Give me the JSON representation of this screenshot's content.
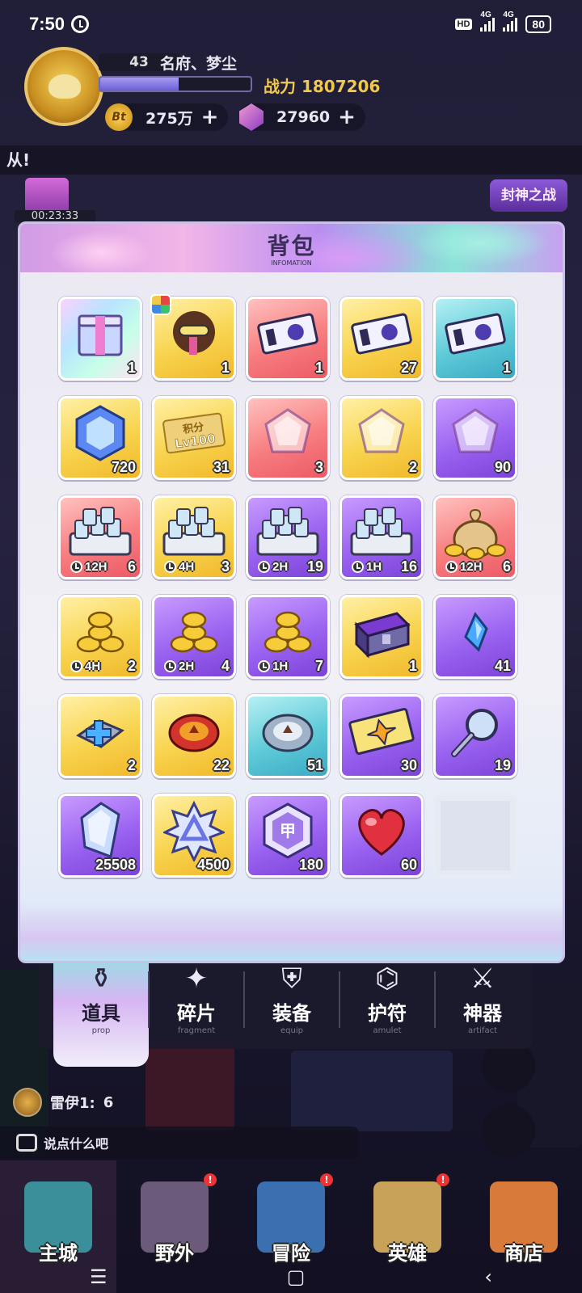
{
  "status_bar": {
    "time": "7:50",
    "network_hd": "HD",
    "net1": "4G",
    "net2": "4G",
    "battery": "80"
  },
  "player": {
    "level": "43",
    "name": "名府、梦尘",
    "exp_fraction": 0.52,
    "power_label": "战力",
    "power_value": "1807206",
    "coins": "275万",
    "coin_symbol": "Bt",
    "gems": "27960",
    "plus": "+"
  },
  "marquee_text": "从!",
  "gift_timer": "00:23:33",
  "event_button": "封神之战",
  "backpack": {
    "title": "背包",
    "subtitle": "INFOMATION",
    "items": [
      {
        "name": "mystery-box",
        "color": "rainbow",
        "icon": "box-icon",
        "count": "1"
      },
      {
        "name": "hero-card",
        "color": "gold",
        "icon": "hero-icon",
        "count": "1"
      },
      {
        "name": "ticket-red",
        "color": "red",
        "icon": "ticket-icon",
        "count": "1"
      },
      {
        "name": "ticket-gold",
        "color": "gold",
        "icon": "ticket-icon",
        "count": "27"
      },
      {
        "name": "ticket-cyan",
        "color": "cyan",
        "icon": "ticket-icon",
        "count": "1"
      },
      {
        "name": "blue-crystal",
        "color": "gold",
        "icon": "hex-gem-icon",
        "count": "720"
      },
      {
        "name": "points-card",
        "color": "gold",
        "icon": "points-card-icon",
        "label": "积分 Lv100",
        "count": "31"
      },
      {
        "name": "red-gem",
        "color": "red",
        "icon": "gem-icon",
        "count": "3"
      },
      {
        "name": "gold-gem",
        "color": "gold",
        "icon": "gem-icon",
        "count": "2"
      },
      {
        "name": "purple-gem",
        "color": "purple",
        "icon": "gem-icon",
        "count": "90"
      },
      {
        "name": "money-chest-12h",
        "color": "red",
        "icon": "cash-stack-icon",
        "timer": "12H",
        "count": "6"
      },
      {
        "name": "money-pile-4h",
        "color": "gold",
        "icon": "cash-stack-icon",
        "timer": "4H",
        "count": "3"
      },
      {
        "name": "money-pile-2h",
        "color": "purple",
        "icon": "cash-stack-icon",
        "timer": "2H",
        "count": "19"
      },
      {
        "name": "money-pile-1h",
        "color": "purple",
        "icon": "cash-stack-icon",
        "timer": "1H",
        "count": "16"
      },
      {
        "name": "coin-bag-12h",
        "color": "red",
        "icon": "coin-bag-icon",
        "timer": "12H",
        "count": "6"
      },
      {
        "name": "coins-4h",
        "color": "gold",
        "icon": "coin-pile-icon",
        "timer": "4H",
        "count": "2"
      },
      {
        "name": "coins-2h",
        "color": "purple",
        "icon": "coin-pile-icon",
        "timer": "2H",
        "count": "4"
      },
      {
        "name": "coins-1h",
        "color": "purple",
        "icon": "coin-pile-icon",
        "timer": "1H",
        "count": "7"
      },
      {
        "name": "purple-chest",
        "color": "gold",
        "icon": "chest-icon",
        "count": "1"
      },
      {
        "name": "blue-shard",
        "color": "purple",
        "icon": "shard-icon",
        "count": "41"
      },
      {
        "name": "cross-plate",
        "color": "gold",
        "icon": "cross-icon",
        "count": "2"
      },
      {
        "name": "red-token",
        "color": "gold",
        "icon": "red-token-icon",
        "count": "22"
      },
      {
        "name": "silver-token",
        "color": "cyan",
        "icon": "silver-token-icon",
        "count": "51"
      },
      {
        "name": "gold-card",
        "color": "purple",
        "icon": "card-icon",
        "count": "30"
      },
      {
        "name": "magnifier",
        "color": "purple",
        "icon": "magnifier-icon",
        "count": "19"
      },
      {
        "name": "crystal",
        "color": "purple",
        "icon": "crystal-icon",
        "count": "25508"
      },
      {
        "name": "star-badge",
        "color": "gold",
        "icon": "star-badge-icon",
        "count": "4500"
      },
      {
        "name": "purple-medal",
        "color": "purple",
        "icon": "medal-icon",
        "count": "180"
      },
      {
        "name": "heart",
        "color": "purple",
        "icon": "heart-icon",
        "count": "60"
      },
      {
        "name": "empty-slot",
        "color": "empty",
        "icon": "",
        "count": ""
      }
    ]
  },
  "tabs": [
    {
      "label": "道具",
      "sub": "prop",
      "icon": "potion-icon",
      "active": true
    },
    {
      "label": "碎片",
      "sub": "fragment",
      "icon": "fragment-icon",
      "active": false
    },
    {
      "label": "装备",
      "sub": "equip",
      "icon": "armor-icon",
      "active": false
    },
    {
      "label": "护符",
      "sub": "amulet",
      "icon": "amulet-icon",
      "active": false
    },
    {
      "label": "神器",
      "sub": "artifact",
      "icon": "sword-icon",
      "active": false
    }
  ],
  "chat": {
    "speaker": "雷伊1:",
    "message": "6",
    "input_placeholder": "说点什么吧"
  },
  "bottom_nav": [
    {
      "label": "主城",
      "active": true,
      "badge": false
    },
    {
      "label": "野外",
      "active": false,
      "badge": true
    },
    {
      "label": "冒险",
      "active": false,
      "badge": true
    },
    {
      "label": "英雄",
      "active": false,
      "badge": true
    },
    {
      "label": "商店",
      "active": false,
      "badge": false
    }
  ],
  "system_nav": {
    "menu": "☰",
    "home": "▢",
    "back": "‹"
  }
}
